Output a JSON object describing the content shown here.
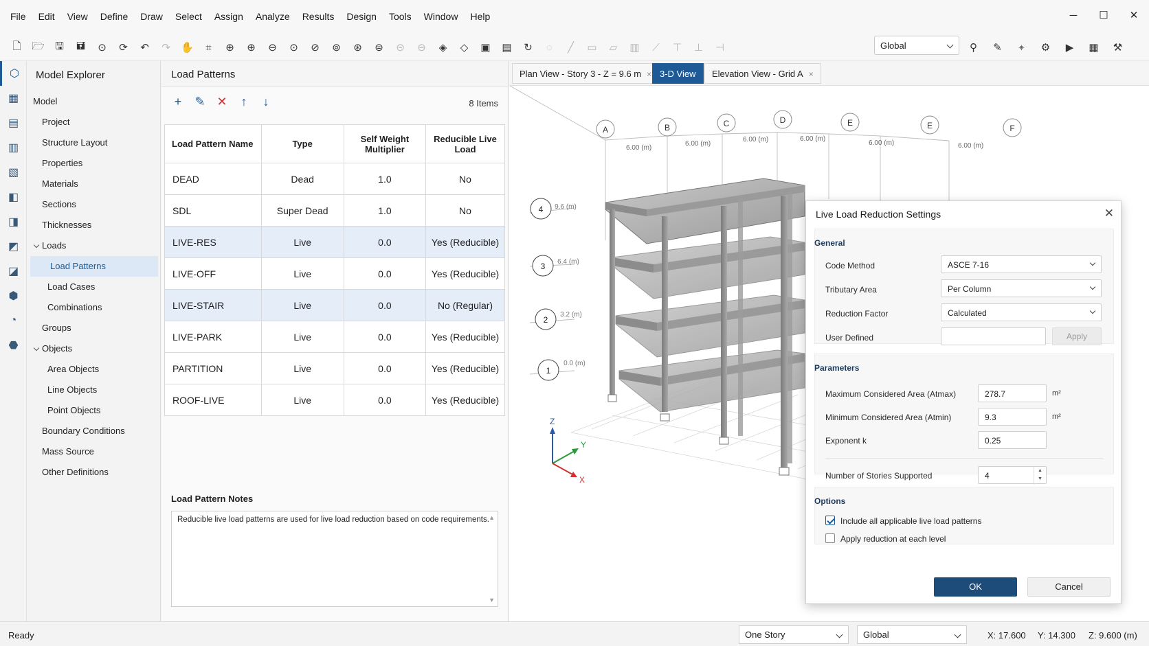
{
  "menu": [
    "File",
    "Edit",
    "View",
    "Define",
    "Draw",
    "Select",
    "Assign",
    "Analyze",
    "Results",
    "Design",
    "Tools",
    "Window",
    "Help"
  ],
  "window_controls": {
    "minimize": "─",
    "maximize": "☐",
    "close": "✕"
  },
  "toolbar": {
    "coord_system": "Global"
  },
  "explorer": {
    "title": "Model Explorer",
    "items": [
      "Model",
      "Project",
      "Structure Layout",
      "Properties",
      "Materials",
      "Sections",
      "Thicknesses",
      "Loads",
      "Load Patterns",
      "Load Cases",
      "Combinations",
      "Groups",
      "Objects",
      "Area Objects",
      "Line Objects",
      "Point Objects",
      "Boundary Conditions",
      "Mass Source",
      "Other Definitions"
    ]
  },
  "load_patterns": {
    "title": "Load Patterns",
    "count": "8 Items",
    "headers": [
      "Load Pattern Name",
      "Type",
      "Self Weight Multiplier",
      "Reducible Live Load"
    ],
    "rows": [
      [
        "DEAD",
        "Dead",
        "1.0",
        "No"
      ],
      [
        "SDL",
        "Super Dead",
        "1.0",
        "No"
      ],
      [
        "LIVE-RES",
        "Live",
        "0.0",
        "Yes (Reducible)"
      ],
      [
        "LIVE-OFF",
        "Live",
        "0.0",
        "Yes (Reducible)"
      ],
      [
        "LIVE-STAIR",
        "Live",
        "0.0",
        "No (Regular)"
      ],
      [
        "LIVE-PARK",
        "Live",
        "0.0",
        "Yes (Reducible)"
      ],
      [
        "PARTITION",
        "Live",
        "0.0",
        "Yes (Reducible)"
      ],
      [
        "ROOF-LIVE",
        "Live",
        "0.0",
        "Yes (Reducible)"
      ]
    ],
    "notes_title": "Load Pattern Notes",
    "notes_text": "Reducible live load patterns are used for live load reduction based on code requirements."
  },
  "tabs": [
    {
      "label": "Plan View - Story 3 - Z = 9.6 m",
      "close": "×"
    },
    {
      "label": "3-D View"
    },
    {
      "label": "Elevation View - Grid A",
      "close": "×"
    }
  ],
  "scene": {
    "grid_letters": [
      "A",
      "B",
      "C",
      "D",
      "E",
      "E",
      "F"
    ],
    "spacing_label": "6.00 (m)",
    "levels": [
      {
        "num": "4",
        "elev": "9.6 (m)"
      },
      {
        "num": "3",
        "elev": "6.4 (m)"
      },
      {
        "num": "2",
        "elev": "3.2 (m)"
      },
      {
        "num": "1",
        "elev": "0.0 (m)"
      }
    ],
    "axes": {
      "z": "Z",
      "y": "Y",
      "x": "X"
    }
  },
  "dialog": {
    "title": "Live Load Reduction Settings",
    "general_title": "General",
    "code_method_label": "Code Method",
    "code_method": "ASCE 7-16",
    "tributary_label": "Tributary Area",
    "tributary": "Per Column",
    "reduction_label": "Reduction Factor",
    "reduction": "Calculated",
    "user_defined_label": "User Defined",
    "apply": "Apply",
    "params_title": "Parameters",
    "atmax_label": "Maximum Considered Area (Atmax)",
    "atmax": "278.7",
    "atmax_unit": "m²",
    "atmin_label": "Minimum Considered Area (Atmin)",
    "atmin": "9.3",
    "atmin_unit": "m²",
    "k_label": "Exponent k",
    "k": "0.25",
    "stories_label": "Number of Stories Supported",
    "stories": "4",
    "options_title": "Options",
    "opt1": "Include all applicable live load patterns",
    "opt1_checked": true,
    "opt2": "Apply reduction at each level",
    "opt2_checked": false,
    "ok": "OK",
    "cancel": "Cancel"
  },
  "status": {
    "text": "Ready",
    "story": "One Story",
    "coord": "Global",
    "x": "X: 17.600",
    "y": "Y: 14.300",
    "z": "Z: 9.600 (m)"
  },
  "colors": {
    "accent": "#1e5a96",
    "selection": "#dce8f5",
    "ok_button": "#1e4c7a"
  }
}
